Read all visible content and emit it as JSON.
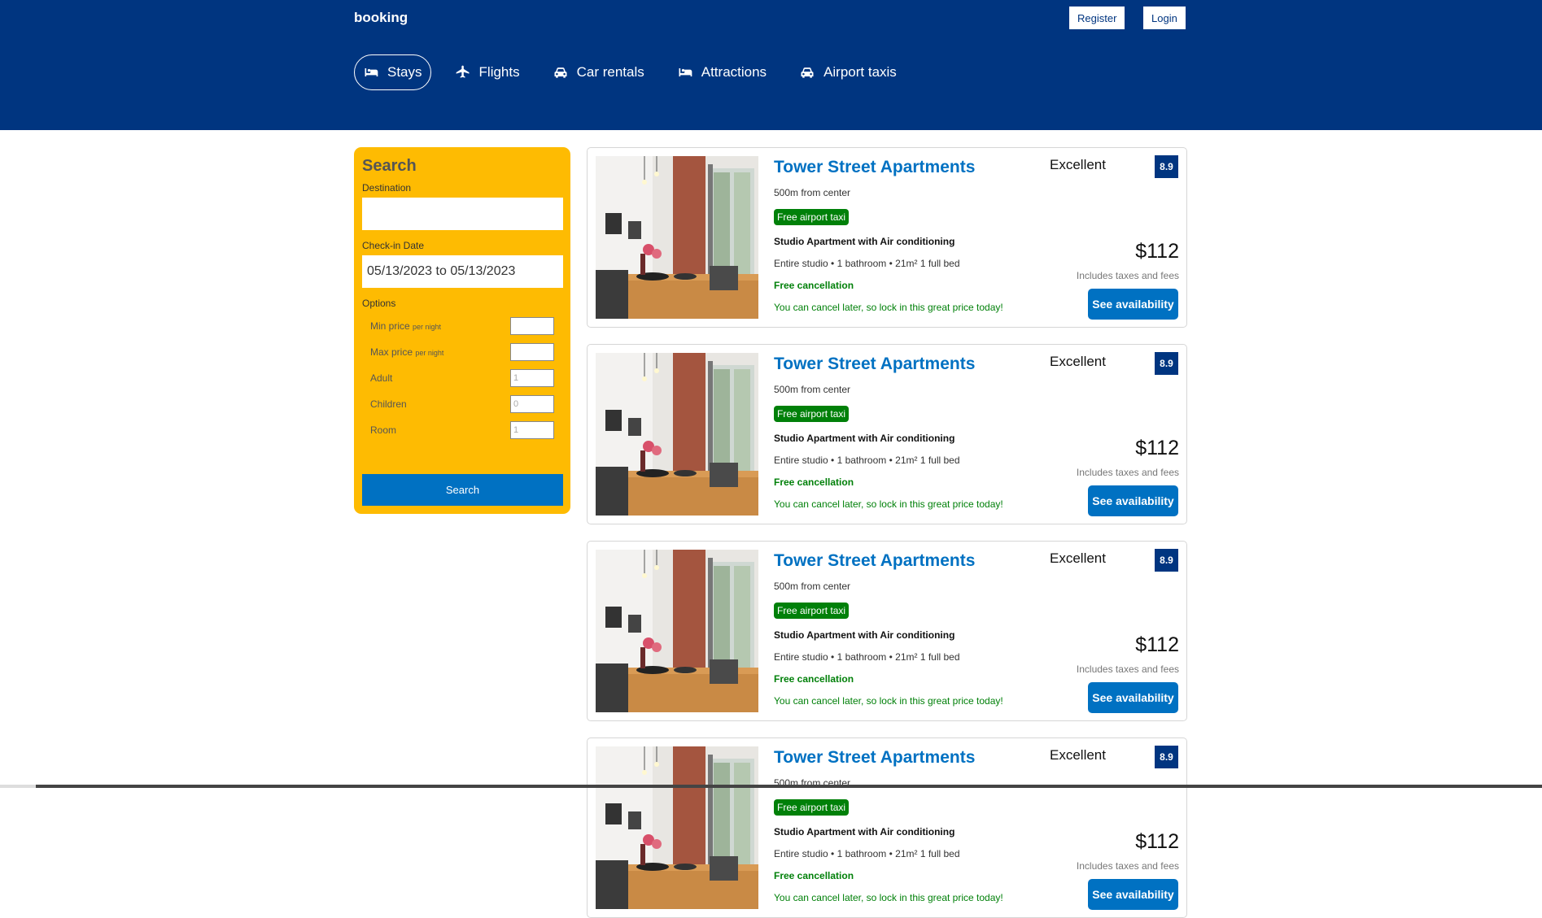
{
  "header": {
    "logo": "booking",
    "register_label": "Register",
    "login_label": "Login",
    "nav": [
      {
        "label": "Stays",
        "icon": "bed-icon",
        "active": true
      },
      {
        "label": "Flights",
        "icon": "plane-icon",
        "active": false
      },
      {
        "label": "Car rentals",
        "icon": "car-icon",
        "active": false
      },
      {
        "label": "Attractions",
        "icon": "bed-icon",
        "active": false
      },
      {
        "label": "Airport taxis",
        "icon": "taxi-icon",
        "active": false
      }
    ]
  },
  "search": {
    "title": "Search",
    "destination_label": "Destination",
    "destination_value": "",
    "checkin_label": "Check-in Date",
    "checkin_value": "05/13/2023 to 05/13/2023",
    "options_label": "Options",
    "options": [
      {
        "label": "Min price",
        "sub": "per night",
        "value": ""
      },
      {
        "label": "Max price",
        "sub": "per night",
        "value": ""
      },
      {
        "label": "Adult",
        "sub": "",
        "value": "1"
      },
      {
        "label": "Children",
        "sub": "",
        "value": "0"
      },
      {
        "label": "Room",
        "sub": "",
        "value": "1"
      }
    ],
    "button_label": "Search"
  },
  "results": [
    {
      "title": "Tower Street Apartments",
      "distance": "500m from center",
      "taxi": "Free airport taxi",
      "subtitle": "Studio Apartment with Air conditioning",
      "features": "Entire studio • 1 bathroom • 21m² 1 full bed",
      "cancel": "Free cancellation",
      "cancel_sub": "You can cancel later, so lock in this great price today!",
      "rating_text": "Excellent",
      "score": "8.9",
      "price": "$112",
      "tax": "Includes taxes and fees",
      "button": "See availability"
    },
    {
      "title": "Tower Street Apartments",
      "distance": "500m from center",
      "taxi": "Free airport taxi",
      "subtitle": "Studio Apartment with Air conditioning",
      "features": "Entire studio • 1 bathroom • 21m² 1 full bed",
      "cancel": "Free cancellation",
      "cancel_sub": "You can cancel later, so lock in this great price today!",
      "rating_text": "Excellent",
      "score": "8.9",
      "price": "$112",
      "tax": "Includes taxes and fees",
      "button": "See availability"
    },
    {
      "title": "Tower Street Apartments",
      "distance": "500m from center",
      "taxi": "Free airport taxi",
      "subtitle": "Studio Apartment with Air conditioning",
      "features": "Entire studio • 1 bathroom • 21m² 1 full bed",
      "cancel": "Free cancellation",
      "cancel_sub": "You can cancel later, so lock in this great price today!",
      "rating_text": "Excellent",
      "score": "8.9",
      "price": "$112",
      "tax": "Includes taxes and fees",
      "button": "See availability"
    },
    {
      "title": "Tower Street Apartments",
      "distance": "500m from center",
      "taxi": "Free airport taxi",
      "subtitle": "Studio Apartment with Air conditioning",
      "features": "Entire studio • 1 bathroom • 21m² 1 full bed",
      "cancel": "Free cancellation",
      "cancel_sub": "You can cancel later, so lock in this great price today!",
      "rating_text": "Excellent",
      "score": "8.9",
      "price": "$112",
      "tax": "Includes taxes and fees",
      "button": "See availability"
    }
  ],
  "colors": {
    "brand": "#003580",
    "accent": "#0071c2",
    "search_bg": "#febb02",
    "green": "#008009"
  }
}
